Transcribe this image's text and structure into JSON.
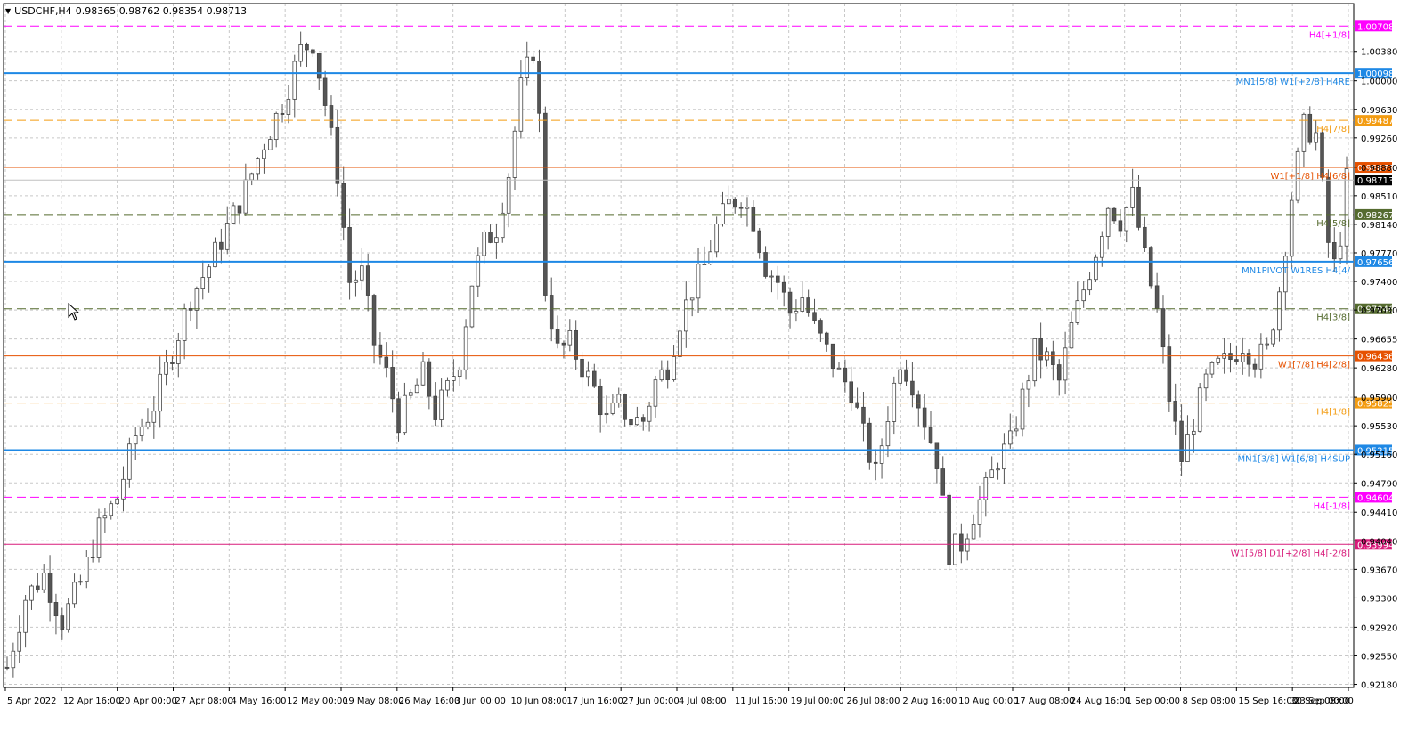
{
  "window": {
    "symbol": "USDCHF,H4",
    "ohlc": "0.98365 0.98762 0.98354 0.98713"
  },
  "chart_data": {
    "type": "candlestick",
    "ylim": [
      0.9214,
      1.01
    ],
    "y_ticks": [
      "1.00380",
      "1.00000",
      "0.99630",
      "0.99260",
      "0.98880",
      "0.98510",
      "0.98140",
      "0.97770",
      "0.97400",
      "0.97030",
      "0.96655",
      "0.96280",
      "0.95900",
      "0.95530",
      "0.95160",
      "0.94790",
      "0.94410",
      "0.94040",
      "0.93670",
      "0.93300",
      "0.92920",
      "0.92550",
      "0.92180"
    ],
    "x_ticks": [
      "5 Apr 2022",
      "12 Apr 16:00",
      "20 Apr 00:00",
      "27 Apr 08:00",
      "4 May 16:00",
      "12 May 00:00",
      "19 May 08:00",
      "26 May 16:00",
      "3 Jun 00:00",
      "10 Jun 08:00",
      "17 Jun 16:00",
      "27 Jun 00:00",
      "4 Jul 08:00",
      "11 Jul 16:00",
      "19 Jul 00:00",
      "26 Jul 08:00",
      "2 Aug 16:00",
      "10 Aug 00:00",
      "17 Aug 08:00",
      "24 Aug 16:00",
      "1 Sep 00:00",
      "8 Sep 08:00",
      "15 Sep 16:00",
      "23 Sep 00:00",
      "30 Sep 08:00"
    ],
    "price_path": [
      [
        0,
        0.924
      ],
      [
        3,
        0.933
      ],
      [
        6,
        0.936
      ],
      [
        9,
        0.93
      ],
      [
        12,
        0.935
      ],
      [
        15,
        0.942
      ],
      [
        18,
        0.946
      ],
      [
        21,
        0.954
      ],
      [
        24,
        0.958
      ],
      [
        27,
        0.965
      ],
      [
        30,
        0.972
      ],
      [
        33,
        0.976
      ],
      [
        36,
        0.981
      ],
      [
        39,
        0.986
      ],
      [
        42,
        0.992
      ],
      [
        45,
        0.997
      ],
      [
        48,
        1.004
      ],
      [
        50,
        1.005
      ],
      [
        52,
        0.997
      ],
      [
        54,
        0.988
      ],
      [
        56,
        0.974
      ],
      [
        58,
        0.975
      ],
      [
        60,
        0.966
      ],
      [
        62,
        0.962
      ],
      [
        64,
        0.956
      ],
      [
        66,
        0.959
      ],
      [
        68,
        0.962
      ],
      [
        70,
        0.957
      ],
      [
        72,
        0.96
      ],
      [
        74,
        0.964
      ],
      [
        76,
        0.974
      ],
      [
        78,
        0.979
      ],
      [
        80,
        0.981
      ],
      [
        82,
        0.988
      ],
      [
        84,
        0.999
      ],
      [
        86,
        1.004
      ],
      [
        87,
        0.995
      ],
      [
        88,
        0.973
      ],
      [
        90,
        0.965
      ],
      [
        92,
        0.966
      ],
      [
        94,
        0.963
      ],
      [
        96,
        0.96
      ],
      [
        98,
        0.956
      ],
      [
        100,
        0.958
      ],
      [
        102,
        0.956
      ],
      [
        104,
        0.956
      ],
      [
        106,
        0.961
      ],
      [
        108,
        0.963
      ],
      [
        110,
        0.969
      ],
      [
        112,
        0.973
      ],
      [
        114,
        0.976
      ],
      [
        116,
        0.981
      ],
      [
        118,
        0.984
      ],
      [
        120,
        0.985
      ],
      [
        122,
        0.982
      ],
      [
        124,
        0.976
      ],
      [
        126,
        0.974
      ],
      [
        128,
        0.97
      ],
      [
        130,
        0.972
      ],
      [
        132,
        0.968
      ],
      [
        134,
        0.965
      ],
      [
        136,
        0.962
      ],
      [
        138,
        0.96
      ],
      [
        140,
        0.954
      ],
      [
        142,
        0.949
      ],
      [
        144,
        0.957
      ],
      [
        146,
        0.964
      ],
      [
        148,
        0.961
      ],
      [
        150,
        0.956
      ],
      [
        152,
        0.951
      ],
      [
        154,
        0.939
      ],
      [
        156,
        0.94
      ],
      [
        158,
        0.944
      ],
      [
        160,
        0.947
      ],
      [
        162,
        0.951
      ],
      [
        164,
        0.953
      ],
      [
        166,
        0.959
      ],
      [
        168,
        0.965
      ],
      [
        170,
        0.964
      ],
      [
        172,
        0.961
      ],
      [
        174,
        0.968
      ],
      [
        176,
        0.973
      ],
      [
        178,
        0.978
      ],
      [
        180,
        0.984
      ],
      [
        182,
        0.982
      ],
      [
        184,
        0.985
      ],
      [
        186,
        0.977
      ],
      [
        188,
        0.97
      ],
      [
        190,
        0.959
      ],
      [
        192,
        0.951
      ],
      [
        194,
        0.956
      ],
      [
        196,
        0.961
      ],
      [
        198,
        0.963
      ],
      [
        200,
        0.964
      ],
      [
        202,
        0.966
      ],
      [
        204,
        0.964
      ],
      [
        206,
        0.965
      ],
      [
        208,
        0.973
      ],
      [
        210,
        0.985
      ],
      [
        212,
        0.994
      ],
      [
        214,
        0.993
      ],
      [
        215,
        0.986
      ],
      [
        216,
        0.979
      ],
      [
        217,
        0.976
      ],
      [
        218,
        0.98
      ],
      [
        219,
        0.9871
      ]
    ],
    "levels": [
      {
        "price": 1.00708,
        "tag": "1.00708",
        "label": "H4[+1/8]",
        "color": "#ff00ff",
        "dash": true,
        "width": 1,
        "label_color": "#ff00ff",
        "tag_text": "#ffffff"
      },
      {
        "price": 1.00098,
        "tag": "1.00098",
        "label": "MN1[5/8] W1[+2/8] H4RE",
        "color": "#1e88e5",
        "dash": false,
        "width": 2,
        "label_color": "#1e88e5",
        "tag_text": "#ffffff"
      },
      {
        "price": 0.99487,
        "tag": "0.99487",
        "label": "H4[7/8]",
        "color": "#f39c12",
        "dash": true,
        "width": 1,
        "label_color": "#f39c12",
        "tag_text": "#ffffff"
      },
      {
        "price": 0.98877,
        "tag": "0.98877",
        "label": "W1[+1/8] H4[6/8]",
        "color": "#e65100",
        "dash": false,
        "width": 1,
        "label_color": "#e65100",
        "tag_text": "#ffffff"
      },
      {
        "price": 0.98267,
        "tag": "0.98267",
        "label": "H4[5/8]",
        "color": "#556b2f",
        "dash": true,
        "width": 1,
        "label_color": "#556b2f",
        "tag_text": "#ffffff"
      },
      {
        "price": 0.97656,
        "tag": "0.97656",
        "label": "MN1PIVOT W1RES H4[4/",
        "color": "#1e88e5",
        "dash": false,
        "width": 2,
        "label_color": "#1e88e5",
        "tag_text": "#ffffff"
      },
      {
        "price": 0.97046,
        "tag": "0.97046",
        "label": "H4[3/8]",
        "color": "#556b2f",
        "dash": true,
        "width": 1,
        "label_color": "#556b2f",
        "tag_text": "#ffffff"
      },
      {
        "price": 0.96436,
        "tag": "0.96436",
        "label": "W1[7/8] H4[2/8]",
        "color": "#e65100",
        "dash": false,
        "width": 1,
        "label_color": "#e65100",
        "tag_text": "#ffffff"
      },
      {
        "price": 0.95825,
        "tag": "0.95825",
        "label": "H4[1/8]",
        "color": "#f39c12",
        "dash": true,
        "width": 1,
        "label_color": "#f39c12",
        "tag_text": "#ffffff"
      },
      {
        "price": 0.95215,
        "tag": "0.95215",
        "label": "MN1[3/8] W1[6/8] H4SUP",
        "color": "#1e88e5",
        "dash": false,
        "width": 2,
        "label_color": "#1e88e5",
        "tag_text": "#ffffff"
      },
      {
        "price": 0.94604,
        "tag": "0.94604",
        "label": "H4[-1/8]",
        "color": "#ff00ff",
        "dash": true,
        "width": 1,
        "label_color": "#ff00ff",
        "tag_text": "#ffffff"
      },
      {
        "price": 0.93994,
        "tag": "0.93994",
        "label": "W1[5/8] D1[+2/8] H4[-2/8]",
        "color": "#d81b7a",
        "dash": false,
        "width": 1,
        "label_color": "#d81b7a",
        "tag_text": "#ffffff"
      }
    ],
    "current_price": {
      "price": 0.98713,
      "tag": "0.98713",
      "color": "#000000"
    },
    "grid": true
  }
}
